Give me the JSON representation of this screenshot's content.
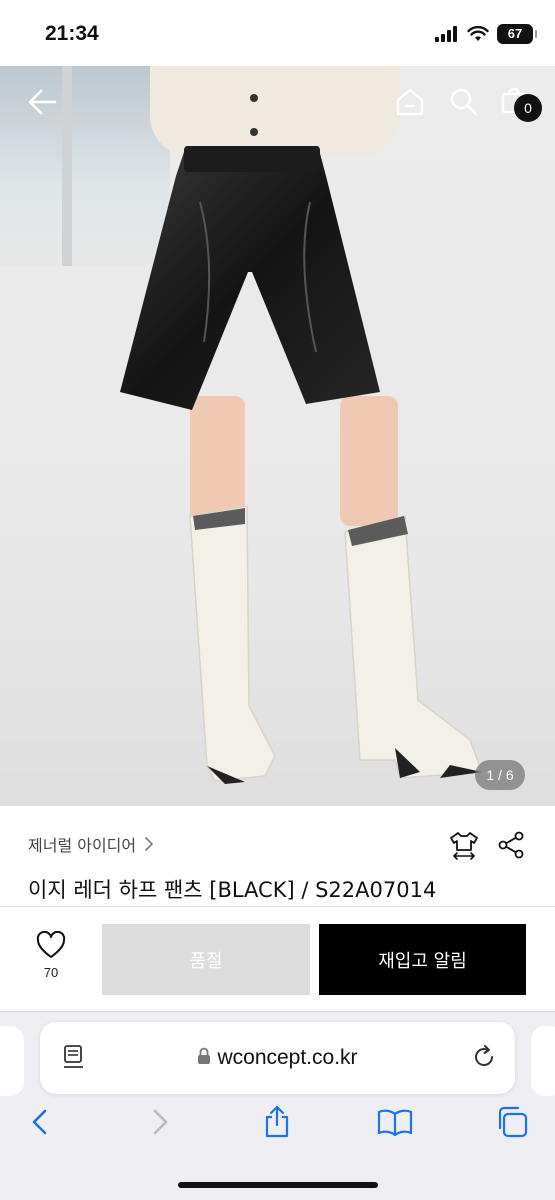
{
  "status_bar": {
    "time": "21:34",
    "battery": "67"
  },
  "product": {
    "image_counter": "1 / 6",
    "cart_count": "0",
    "brand": "제너럴 아이디어",
    "title": "이지 레더 하프 팬츠 [BLACK] / S22A07014"
  },
  "actions": {
    "wish_count": "70",
    "soldout_label": "품절",
    "notify_label": "재입고 알림"
  },
  "browser": {
    "url": "wconcept.co.kr"
  },
  "colors": {
    "accent": "#000000",
    "soldout_bg": "#dcdcdc",
    "browser_bg": "#efeff3",
    "link_blue": "#1a73e8"
  },
  "icons": [
    "back-arrow-icon",
    "home-icon",
    "search-icon",
    "shopping-bag-icon",
    "chevron-right-icon",
    "size-guide-icon",
    "share-icon",
    "heart-icon",
    "lock-icon",
    "reader-icon",
    "reload-icon",
    "back-icon",
    "forward-icon",
    "share-sheet-icon",
    "bookmarks-icon",
    "tabs-icon"
  ]
}
